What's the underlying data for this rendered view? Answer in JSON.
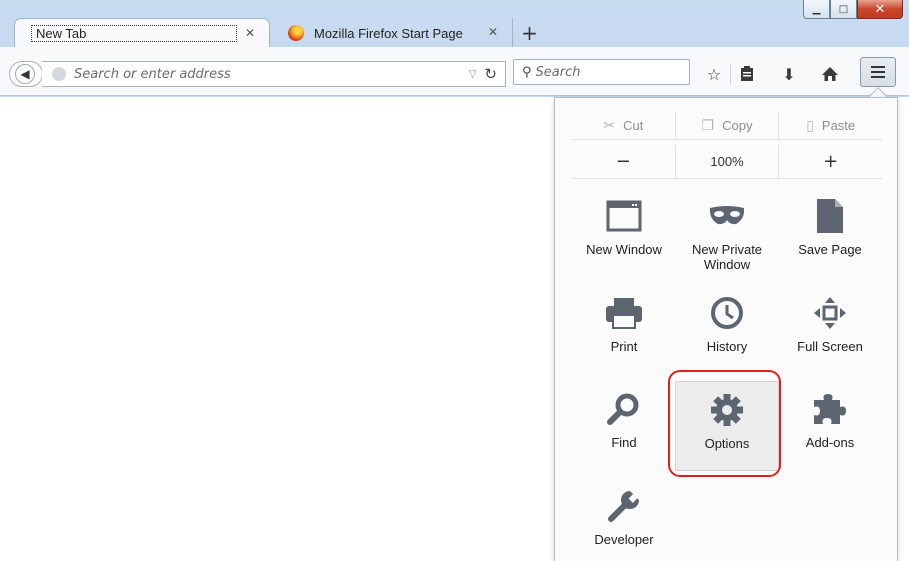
{
  "window": {
    "caption_min": "▁",
    "caption_max": "□",
    "caption_close": "✕"
  },
  "tabs": [
    {
      "title": "New Tab",
      "active": true,
      "close": "✕"
    },
    {
      "title": "Mozilla Firefox Start Page",
      "active": false,
      "close": "✕"
    }
  ],
  "new_tab_label": "+",
  "navbar": {
    "back_glyph": "◀",
    "url_placeholder": "Search or enter address",
    "url_dropdown": "▽",
    "reload_glyph": "↻",
    "search_placeholder": "Search",
    "search_glyph": "⚲",
    "bookmark_star": "☆",
    "bookmarks_menu": "▣",
    "downloads": "⬇",
    "home": "⌂"
  },
  "menu": {
    "edit": [
      {
        "label": "Cut",
        "icon": "cut-icon",
        "glyph": "✂"
      },
      {
        "label": "Copy",
        "icon": "copy-icon",
        "glyph": "❐"
      },
      {
        "label": "Paste",
        "icon": "paste-icon",
        "glyph": "▯"
      }
    ],
    "zoom": {
      "out": "−",
      "level": "100%",
      "in": "+"
    },
    "items": [
      {
        "label": "New Window",
        "icon": "new-window-icon"
      },
      {
        "label": "New Private\nWindow",
        "icon": "mask-icon"
      },
      {
        "label": "Save Page",
        "icon": "save-page-icon"
      },
      {
        "label": "Print",
        "icon": "printer-icon"
      },
      {
        "label": "History",
        "icon": "clock-icon"
      },
      {
        "label": "Full Screen",
        "icon": "fullscreen-icon"
      },
      {
        "label": "Find",
        "icon": "magnifier-icon"
      },
      {
        "label": "Options",
        "icon": "gear-icon"
      },
      {
        "label": "Add-ons",
        "icon": "puzzle-icon"
      },
      {
        "label": "Developer",
        "icon": "wrench-icon"
      }
    ]
  },
  "colors": {
    "highlight_ring": "#e0201a",
    "icon_gray": "#5d6670"
  }
}
